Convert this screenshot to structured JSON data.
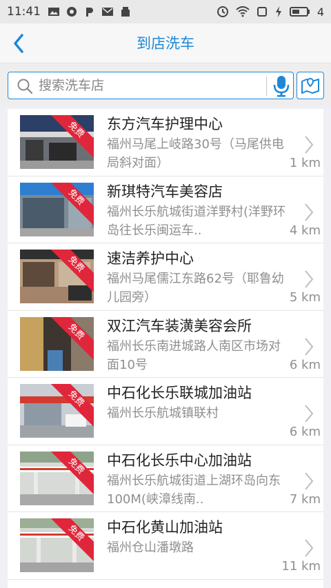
{
  "status_bar": {
    "time": "11:41",
    "battery_level": "4"
  },
  "nav": {
    "title": "到店洗车"
  },
  "search": {
    "placeholder": "搜索洗车店"
  },
  "badge_text": "免费",
  "colors": {
    "accent": "#1e88d6",
    "ribbon": "#e0263a"
  },
  "stores": [
    {
      "name": "东方汽车护理中心",
      "address": "福州马尾上岐路30号（马尾供电局斜对面）",
      "distance": "1 km"
    },
    {
      "name": "新琪特汽车美容店",
      "address": "福州长乐航城街道洋野村(洋野环岛往长乐闽运车..",
      "distance": "4 km"
    },
    {
      "name": "速洁养护中心",
      "address": "福州马尾儒江东路62号（耶鲁幼儿园旁）",
      "distance": "5 km"
    },
    {
      "name": "双江汽车装潢美容会所",
      "address": "福州长乐南进城路人南区市场对面10号",
      "distance": "6 km"
    },
    {
      "name": "中石化长乐联城加油站",
      "address": "福州长乐航城镇联村",
      "distance": "6 km"
    },
    {
      "name": "中石化长乐中心加油站",
      "address": "福州长乐航城街道上湖环岛向东100M(峡漳线南..",
      "distance": "7 km"
    },
    {
      "name": "中石化黄山加油站",
      "address": "福州仓山潘墩路",
      "distance": "11 km"
    }
  ]
}
